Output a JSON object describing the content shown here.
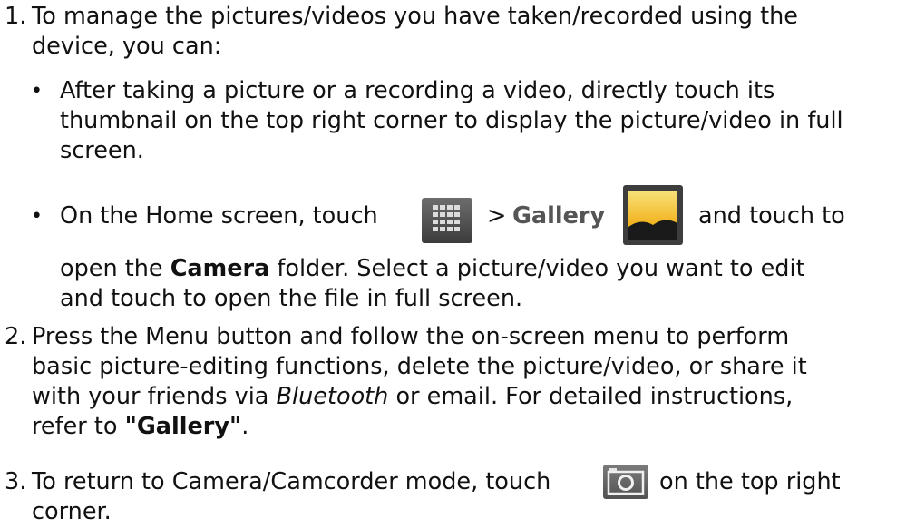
{
  "list": {
    "item1": {
      "number": "1.",
      "line1": "To manage the pictures/videos you have taken/recorded using the",
      "line2": "device, you can:"
    },
    "bullet1": {
      "symbol": "•",
      "line1": "After taking a picture or a recording a video, directly touch its",
      "line2": "thumbnail on the top right corner to display the picture/video in full",
      "line3": "screen."
    },
    "bullet2": {
      "symbol": "•",
      "text_before_icon": "On the Home screen, touch",
      "separator": ">",
      "gallery_label": "Gallery",
      "text_after_icon": "and touch to",
      "line2_before": "open the",
      "camera_label": "Camera",
      "line2_after": "folder. Select a picture/video you want to edit",
      "line3": "and touch to open the file in full screen.",
      "apps_icon": "apps-grid-icon",
      "gallery_icon": "gallery-icon"
    },
    "item2": {
      "number": "2.",
      "line1": "Press the Menu button and follow the on-screen menu to perform",
      "line2": "basic picture-editing functions, delete the picture/video, or share it",
      "line3_before": "with your friends via",
      "bluetooth": "Bluetooth",
      "line3_after": "or email. For detailed instructions,",
      "line4_before": "refer to",
      "gallery_ref": "\"Gallery\"",
      "line4_after": "."
    },
    "item3": {
      "number": "3.",
      "text_before_icon": "To return to Camera/Camcorder mode, touch",
      "text_after_icon": "on the top right",
      "line2": "corner.",
      "camera_icon": "camera-icon"
    }
  }
}
